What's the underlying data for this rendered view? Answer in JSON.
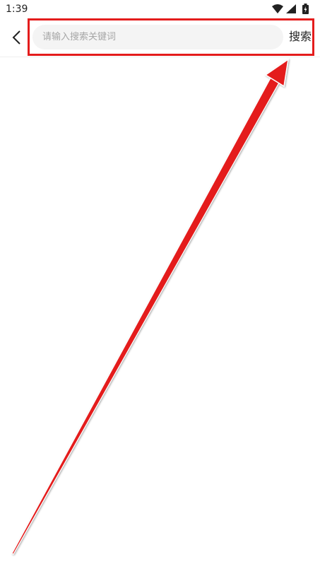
{
  "status_bar": {
    "time": "1:39",
    "icons": [
      "wifi-icon",
      "signal-icon",
      "battery-icon"
    ]
  },
  "header": {
    "back_icon": "chevron-left-icon",
    "search_placeholder": "请输入搜索关键词",
    "search_value": "",
    "search_button_label": "搜索"
  },
  "annotation": {
    "color": "#e41c1c"
  }
}
